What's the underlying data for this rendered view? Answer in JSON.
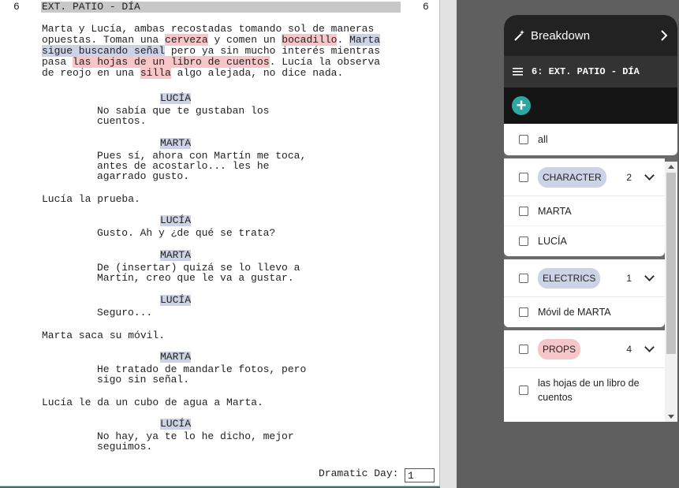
{
  "script": {
    "scene_number": "6",
    "scene_heading": "EXT. PATIO - DÍA",
    "action1": {
      "l1a": "Marta y Lucía, ambas recostadas tomando sol de maneras",
      "l2a": "opuestas. Toman una ",
      "l2b": "cerveza",
      "l2c": " y comen un ",
      "l2d": "bocadillo",
      "l2e": ". ",
      "l2f": "Marta",
      "l3a": "sigue buscando señal",
      "l3b": " pero ya sin mucho interés mientras",
      "l4a": "pasa ",
      "l4b": "las hojas de un libro de cuentos",
      "l4c": ". Lucía la observa",
      "l5a": "de reojo en una ",
      "l5b": "silla",
      "l5c": " algo alejada, no dice nada."
    },
    "d1": {
      "cue": "LUCÍA",
      "l1": "No sabía que te gustaban los",
      "l2": "cuentos."
    },
    "d2": {
      "cue": "MARTA",
      "l1": "Pues sí, ahora con Martín me toca,",
      "l2": "antes de acostarlo... les he",
      "l3": "agarrado gusto."
    },
    "action2": "Lucía la prueba.",
    "d3": {
      "cue": "LUCÍA",
      "l1": "Gusto. Ah y ¿de qué se trata?"
    },
    "d4": {
      "cue": "MARTA",
      "l1": "De (insertar) quizá se lo llevo a",
      "l2": "Martín, creo que le va a gustar."
    },
    "d5": {
      "cue": "LUCÍA",
      "l1": "Seguro..."
    },
    "action3": "Marta saca su móvil.",
    "d6": {
      "cue": "MARTA",
      "l1": "He tratado de mandarle fotos, pero",
      "l2": "sigo sin señal."
    },
    "action4": "Lucía le da un cubo de agua a Marta.",
    "d7": {
      "cue": "LUCÍA",
      "l1": "No hay, ya te lo he dicho, mejor",
      "l2": "seguimos."
    },
    "dramatic_day_label": "Dramatic Day:",
    "dramatic_day_value": "1"
  },
  "panel": {
    "title": "Breakdown",
    "scene_label": "6: EXT. PATIO - DÍA",
    "all_label": "all",
    "groups": [
      {
        "label": "CHARACTER",
        "count": "2",
        "color": "#cdd3e6",
        "items": [
          "MARTA",
          "LUCÍA"
        ]
      },
      {
        "label": "ELECTRICS",
        "count": "1",
        "color": "#cdd3e6",
        "items": [
          "Móvil de MARTA"
        ]
      },
      {
        "label": "PROPS",
        "count": "4",
        "color": "#f6c6c8",
        "items": [
          "las hojas de un libro de cuentos"
        ]
      }
    ],
    "accent": "#2ca7a2"
  }
}
